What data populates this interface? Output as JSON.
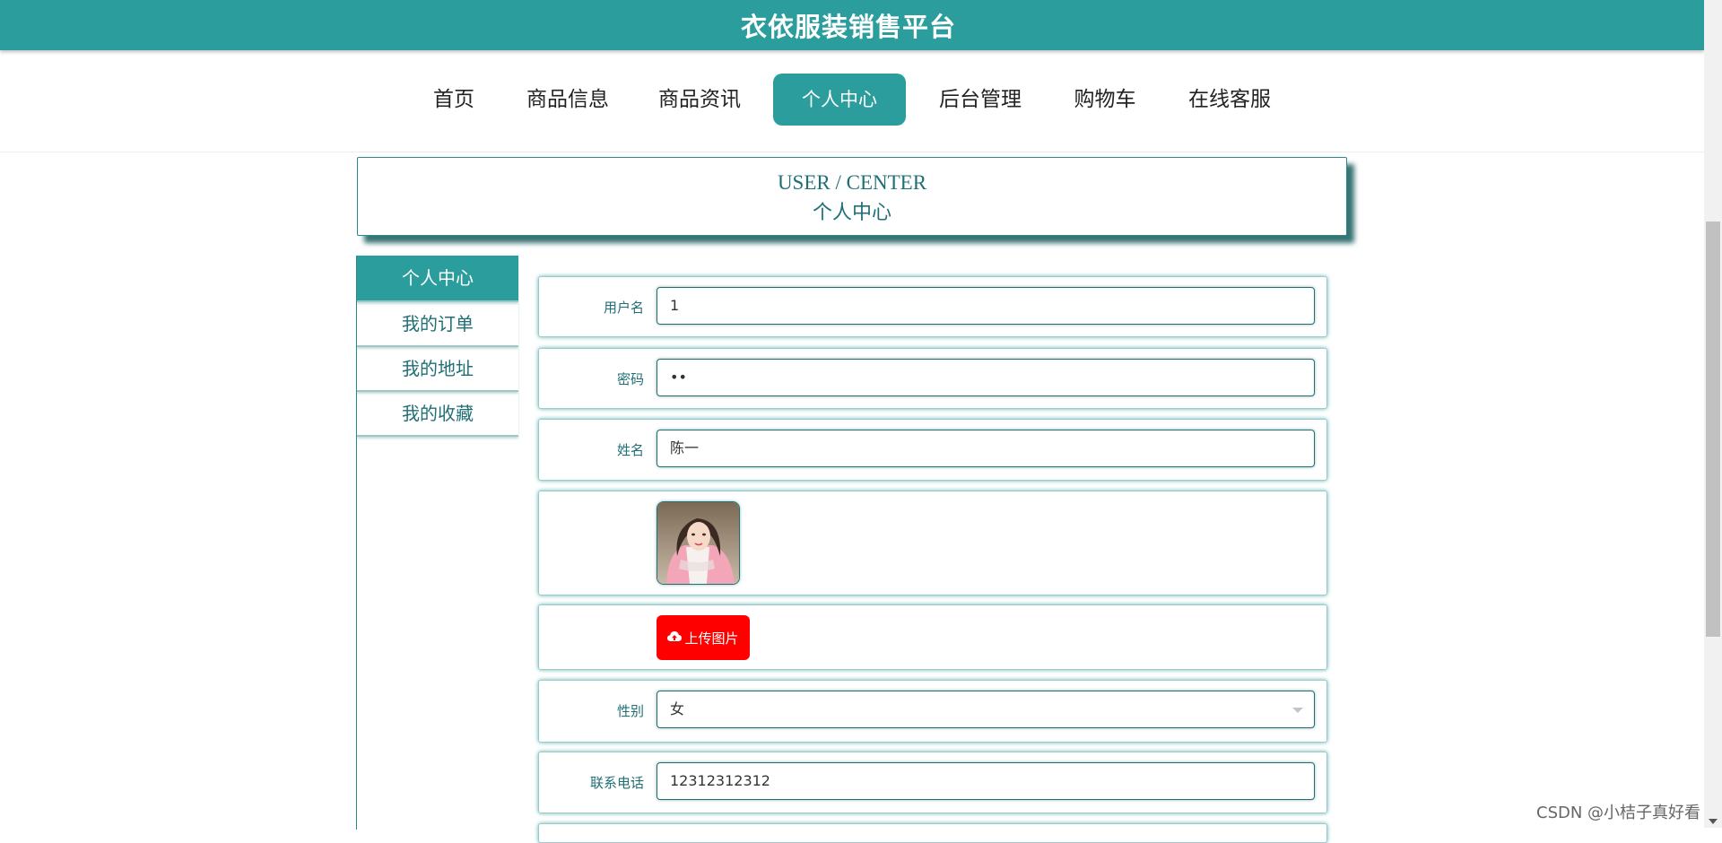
{
  "header": {
    "title": "衣依服装销售平台"
  },
  "nav": {
    "items": [
      {
        "label": "首页"
      },
      {
        "label": "商品信息"
      },
      {
        "label": "商品资讯"
      },
      {
        "label": "个人中心"
      },
      {
        "label": "后台管理"
      },
      {
        "label": "购物车"
      },
      {
        "label": "在线客服"
      }
    ],
    "active": "个人中心"
  },
  "user_center": {
    "title_en": "USER / CENTER",
    "title_cn": "个人中心"
  },
  "sidebar": {
    "items": [
      {
        "label": "个人中心"
      },
      {
        "label": "我的订单"
      },
      {
        "label": "我的地址"
      },
      {
        "label": "我的收藏"
      }
    ],
    "active": "个人中心"
  },
  "form": {
    "username": {
      "label": "用户名",
      "value": "1"
    },
    "password": {
      "label": "密码",
      "value": "••"
    },
    "name": {
      "label": "姓名",
      "value": "陈一"
    },
    "avatar": {
      "description": "user-avatar-photo"
    },
    "upload": {
      "label": "上传图片",
      "icon": "cloud-upload-icon"
    },
    "gender": {
      "label": "性别",
      "value": "女"
    },
    "phone": {
      "label": "联系电话",
      "value": "12312312312"
    }
  },
  "watermark": "CSDN @小桔子真好看",
  "colors": {
    "primary": "#2a9d9c",
    "text_teal": "#1f6f75",
    "upload_button": "#ff0000"
  }
}
